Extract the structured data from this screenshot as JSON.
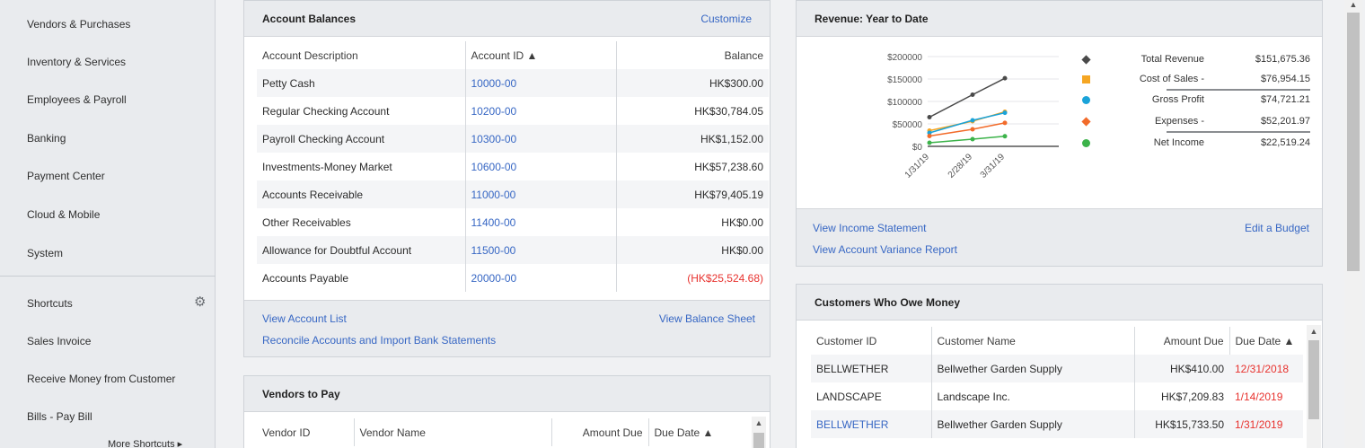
{
  "sidebar": {
    "items": [
      {
        "label": "Vendors & Purchases"
      },
      {
        "label": "Inventory & Services"
      },
      {
        "label": "Employees & Payroll"
      },
      {
        "label": "Banking"
      },
      {
        "label": "Payment Center"
      },
      {
        "label": "Cloud & Mobile"
      },
      {
        "label": "System"
      }
    ],
    "shortcuts_label": "Shortcuts",
    "shortcuts": [
      {
        "label": "Sales Invoice"
      },
      {
        "label": "Receive Money from Customer"
      },
      {
        "label": "Bills - Pay Bill"
      }
    ],
    "more_shortcuts": "More Shortcuts ▸"
  },
  "account_balances": {
    "title": "Account Balances",
    "customize": "Customize",
    "columns": {
      "description": "Account Description",
      "id": "Account ID ▲",
      "balance": "Balance"
    },
    "rows": [
      {
        "description": "Petty Cash",
        "id": "10000-00",
        "balance": "HK$300.00"
      },
      {
        "description": "Regular Checking Account",
        "id": "10200-00",
        "balance": "HK$30,784.05"
      },
      {
        "description": "Payroll Checking Account",
        "id": "10300-00",
        "balance": "HK$1,152.00"
      },
      {
        "description": "Investments-Money Market",
        "id": "10600-00",
        "balance": "HK$57,238.60"
      },
      {
        "description": "Accounts Receivable",
        "id": "11000-00",
        "balance": "HK$79,405.19"
      },
      {
        "description": "Other Receivables",
        "id": "11400-00",
        "balance": "HK$0.00"
      },
      {
        "description": "Allowance for Doubtful Account",
        "id": "11500-00",
        "balance": "HK$0.00"
      },
      {
        "description": "Accounts Payable",
        "id": "20000-00",
        "balance": "(HK$25,524.68)"
      }
    ],
    "view_account_list": "View Account List",
    "view_balance_sheet": "View Balance Sheet",
    "reconcile": "Reconcile Accounts and Import Bank Statements"
  },
  "vendors_to_pay": {
    "title": "Vendors to Pay",
    "columns": {
      "id": "Vendor ID",
      "name": "Vendor Name",
      "amount": "Amount Due",
      "due": "Due Date ▲"
    }
  },
  "revenue": {
    "title": "Revenue: Year to Date",
    "view_income": "View Income Statement",
    "view_variance": "View Account Variance Report",
    "edit_budget": "Edit a Budget",
    "legend": [
      {
        "label": "Total Revenue",
        "value": "$151,675.36",
        "color": "#4a4a4a",
        "marker": "diamond"
      },
      {
        "label": "Cost of Sales -",
        "value": "$76,954.15",
        "color": "#f5a623",
        "marker": "square"
      },
      {
        "label": "Gross Profit",
        "value": "$74,721.21",
        "color": "#1aa3d9",
        "marker": "circle"
      },
      {
        "label": "Expenses -",
        "value": "$52,201.97",
        "color": "#f26b2a",
        "marker": "diamond"
      },
      {
        "label": "Net Income",
        "value": "$22,519.24",
        "color": "#3cb34a",
        "marker": "circle"
      }
    ]
  },
  "chart_data": {
    "type": "line",
    "x": [
      "1/31/19",
      "2/28/19",
      "3/31/19"
    ],
    "ylim": [
      0,
      200000
    ],
    "yticks": [
      "$200000",
      "$150000",
      "$100000",
      "$50000",
      "$0"
    ],
    "series": [
      {
        "name": "Total Revenue",
        "color": "#4a4a4a",
        "values": [
          65000,
          115000,
          151675
        ]
      },
      {
        "name": "Cost of Sales",
        "color": "#f5a623",
        "values": [
          35000,
          56000,
          76954
        ]
      },
      {
        "name": "Gross Profit",
        "color": "#1aa3d9",
        "values": [
          30000,
          58000,
          74721
        ]
      },
      {
        "name": "Expenses",
        "color": "#f26b2a",
        "values": [
          23000,
          38000,
          52202
        ]
      },
      {
        "name": "Net Income",
        "color": "#3cb34a",
        "values": [
          8000,
          16000,
          22519
        ]
      }
    ]
  },
  "customers": {
    "title": "Customers Who Owe Money",
    "columns": {
      "id": "Customer ID",
      "name": "Customer Name",
      "amount": "Amount Due",
      "due": "Due Date ▲"
    },
    "rows": [
      {
        "id": "BELLWETHER",
        "name": "Bellwether Garden Supply",
        "amount": "HK$410.00",
        "due": "12/31/2018"
      },
      {
        "id": "LANDSCAPE",
        "name": "Landscape Inc.",
        "amount": "HK$7,209.83",
        "due": "1/14/2019"
      },
      {
        "id": "BELLWETHER",
        "name": "Bellwether Garden Supply",
        "amount": "HK$15,733.50",
        "due": "1/31/2019"
      }
    ]
  }
}
